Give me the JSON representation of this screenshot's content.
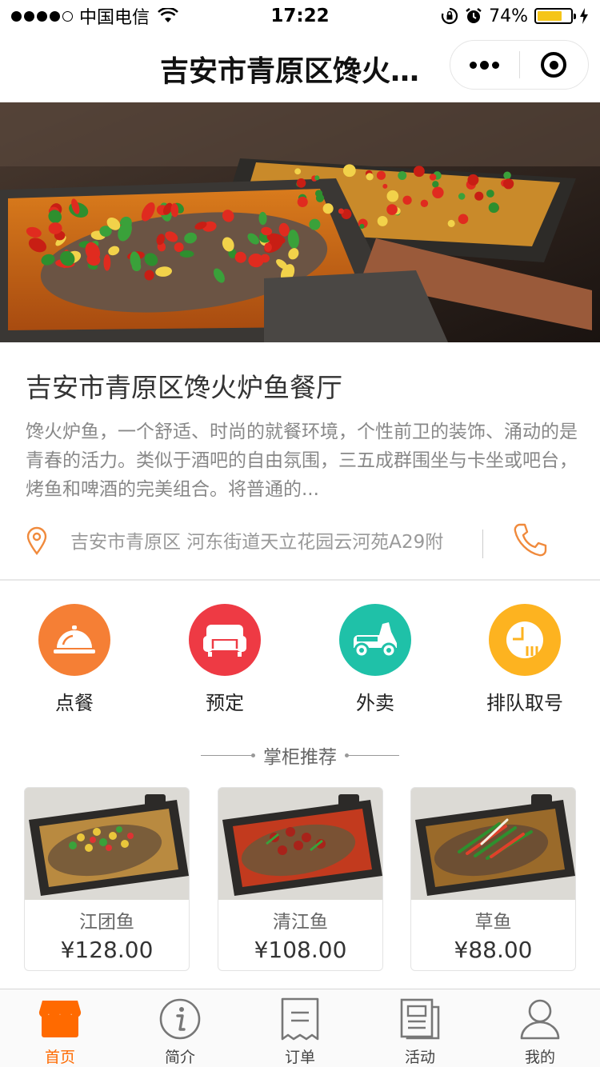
{
  "status_bar": {
    "carrier": "中国电信",
    "time": "17:22",
    "battery": "74%",
    "battery_level": 0.74
  },
  "nav": {
    "title": "吉安市青原区馋火炉鱼餐厅"
  },
  "banner": {
    "slide_count": 5,
    "active_slide": 1
  },
  "restaurant": {
    "name": "吉安市青原区馋火炉鱼餐厅",
    "description": "馋火炉鱼，一个舒适、时尚的就餐环境，个性前卫的装饰、涌动的是青春的活力。类似于酒吧的自由氛围，三五成群围坐与卡坐或吧台，烤鱼和啤酒的完美组合。将普通的...",
    "address": "吉安市青原区 河东街道天立花园云河苑A29附"
  },
  "features": [
    {
      "label": "点餐",
      "icon": "cloche-icon",
      "color": "#f57f35"
    },
    {
      "label": "预定",
      "icon": "sofa-icon",
      "color": "#ee3a44"
    },
    {
      "label": "外卖",
      "icon": "scooter-icon",
      "color": "#1fc1a8"
    },
    {
      "label": "排队取号",
      "icon": "queue-clock-icon",
      "color": "#fdb320"
    }
  ],
  "section": {
    "title": "掌柜推荐"
  },
  "products": [
    {
      "name": "江团鱼",
      "price": "¥128.00"
    },
    {
      "name": "清江鱼",
      "price": "¥108.00"
    },
    {
      "name": "草鱼",
      "price": "¥88.00"
    }
  ],
  "tabs": [
    {
      "label": "首页",
      "icon": "storefront-icon",
      "active": true
    },
    {
      "label": "简介",
      "icon": "info-icon",
      "active": false
    },
    {
      "label": "订单",
      "icon": "receipt-icon",
      "active": false
    },
    {
      "label": "活动",
      "icon": "news-icon",
      "active": false
    },
    {
      "label": "我的",
      "icon": "user-icon",
      "active": false
    }
  ],
  "colors": {
    "accent": "#ff6a00",
    "icon_orange": "#f08a3c"
  }
}
